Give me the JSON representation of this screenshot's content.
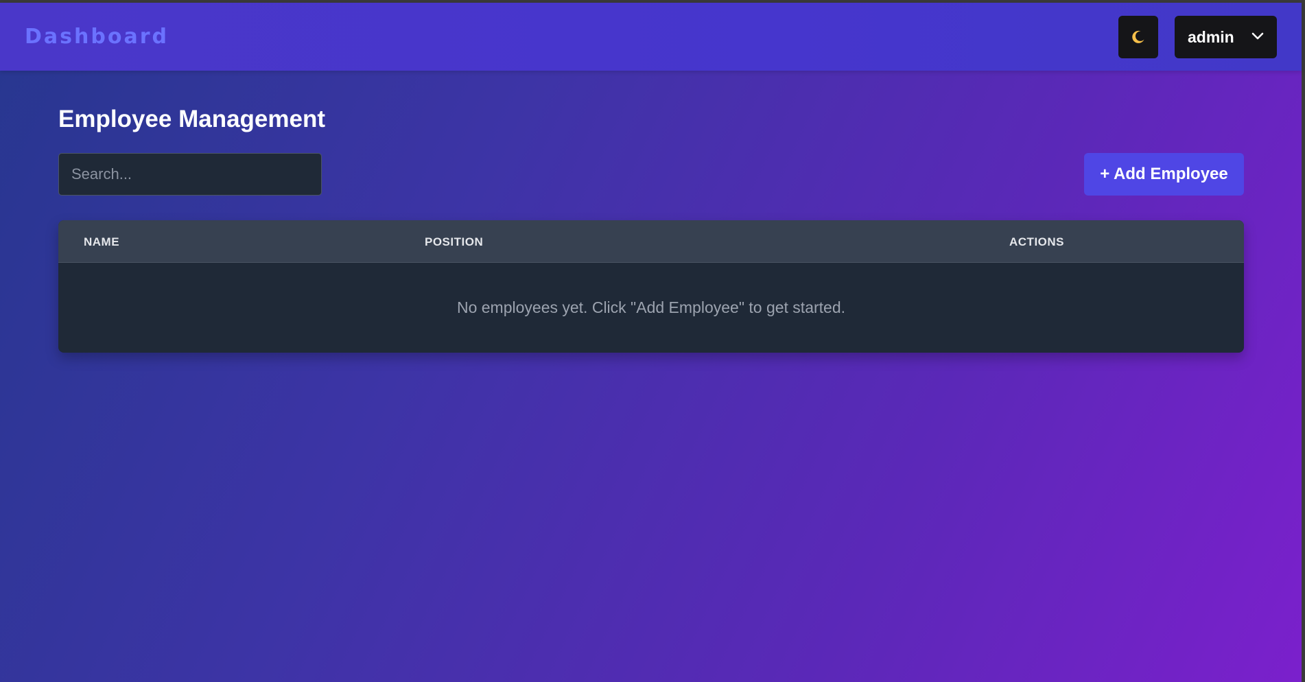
{
  "navbar": {
    "brand": "Dashboard",
    "theme_toggle_icon": "moon-icon",
    "user_menu": {
      "label": "admin",
      "icon": "chevron-down-icon"
    }
  },
  "main": {
    "title": "Employee Management",
    "search": {
      "placeholder": "Search...",
      "value": ""
    },
    "add_button_label": "+ Add Employee",
    "table": {
      "columns": [
        "NAME",
        "POSITION",
        "ACTIONS"
      ],
      "rows": [],
      "empty_message": "No employees yet. Click \"Add Employee\" to get started."
    }
  },
  "colors": {
    "brand_text": "#6b72ff",
    "accent": "#4f46e5",
    "table_header_bg": "#374151",
    "table_body_bg": "#1f2937",
    "icon_moon": "#f6c04a"
  }
}
